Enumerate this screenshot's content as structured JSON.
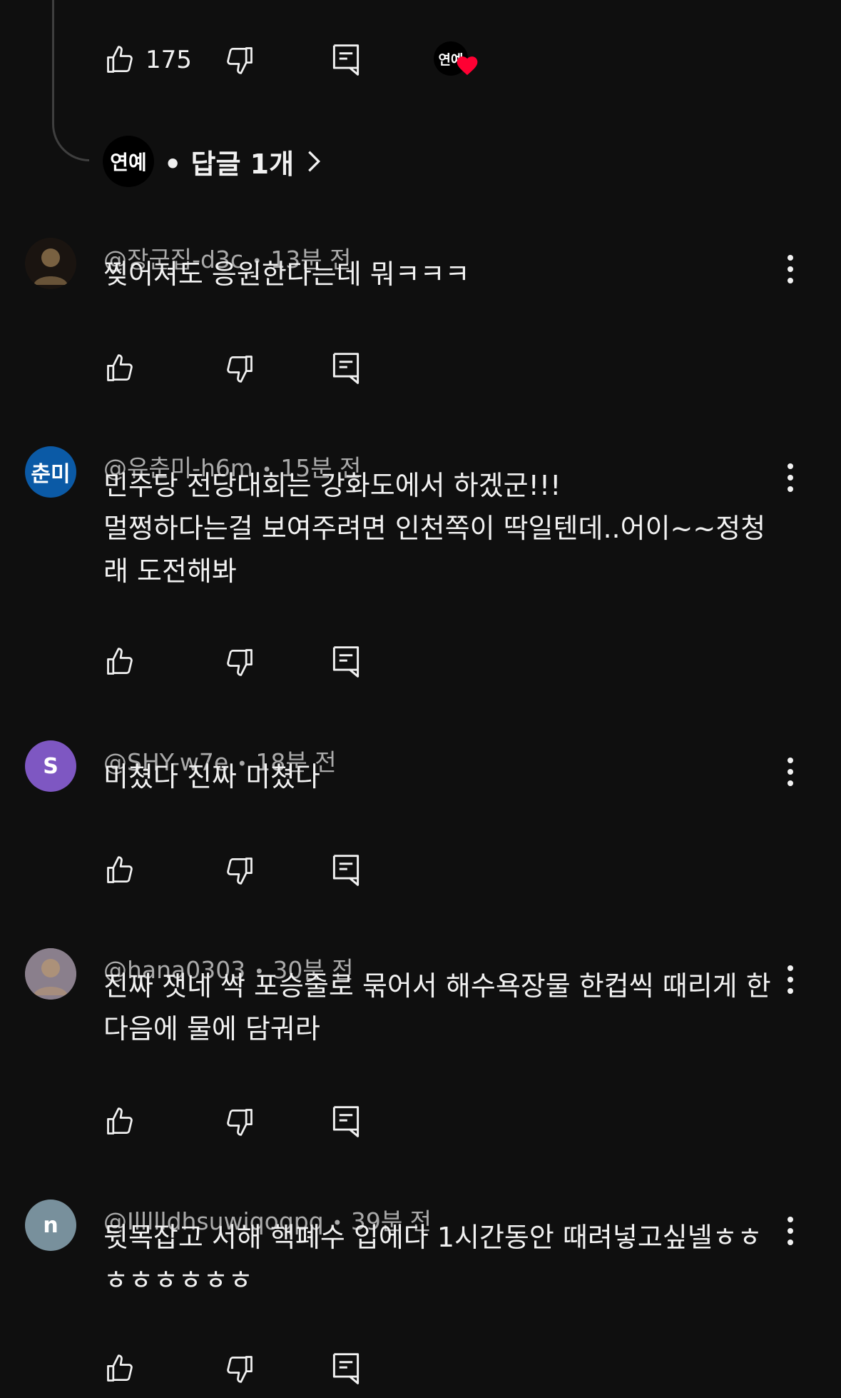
{
  "top_comment": {
    "like_count": "175",
    "creator_badge": "연예",
    "replies_label": "• 답글 1개"
  },
  "comments": [
    {
      "handle": "@장군집-d3c",
      "time": "13분 전",
      "text": "찢어져도 응원한다는데 뭐ㅋㅋㅋ",
      "avatar_text": "",
      "avatar_color": "#1a1410"
    },
    {
      "handle": "@유춘미-h6m",
      "time": "15분 전",
      "text": "민주당 전당대회는 강화도에서 하겠군!!!\n멀쩡하다는걸 보여주려면 인천쪽이 딱일텐데..어이~~정청래 도전해봐",
      "avatar_text": "춘미",
      "avatar_color": "#0b5aa6"
    },
    {
      "handle": "@SHY-w7e",
      "time": "18분 전",
      "text": "미쳤다 진짜 미쳤다",
      "avatar_text": "S",
      "avatar_color": "#7e57c2"
    },
    {
      "handle": "@hana0303",
      "time": "30분 전",
      "text": "진짜 잿네 싹 포승줄로 묶어서 해수욕장물 한컵씩 때리게 한다음에 물에 담궈라",
      "avatar_text": "",
      "avatar_color": "#8a7f8c"
    },
    {
      "handle": "@Illllldhsuwiqoqpq",
      "time": "39분 전",
      "text": "뒷목잡고 서해 핵폐수 입에다 1시간동안 때려넣고싶넬ㅎㅎㅎㅎㅎㅎㅎㅎ",
      "avatar_text": "n",
      "avatar_color": "#78909c"
    }
  ],
  "icons": {
    "like": "thumb-up-icon",
    "dislike": "thumb-down-icon",
    "reply": "comment-icon",
    "more": "more-vert-icon",
    "heart": "heart-icon",
    "chevron": "chevron-right-icon"
  },
  "colors": {
    "background": "#0f0f0f",
    "text": "#f1f1f1",
    "meta": "#aaaaaa",
    "heart": "#ff0033"
  }
}
